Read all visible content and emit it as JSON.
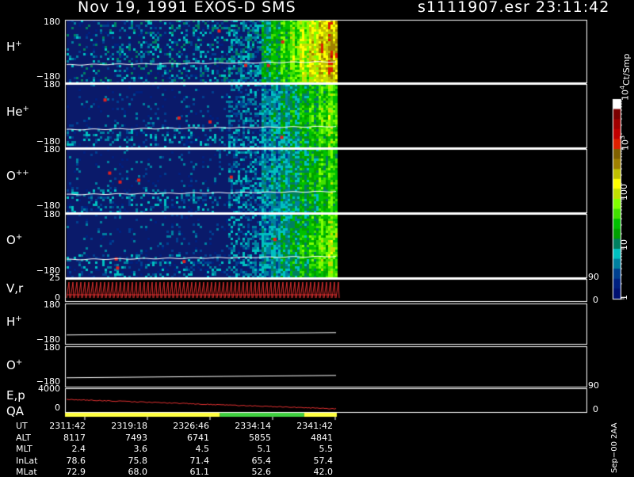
{
  "header": {
    "title": "Nov 19, 1991   EXOS-D SMS",
    "file": "s1111907.esr  23:11:42"
  },
  "panels": [
    {
      "label": "H",
      "sup": "+",
      "ymax": "180",
      "ymin": "−180",
      "type": "spectrogram"
    },
    {
      "label": "He",
      "sup": "+",
      "ymax": "180",
      "ymin": "−180",
      "type": "spectrogram"
    },
    {
      "label": "O",
      "sup": "++",
      "ymax": "180",
      "ymin": "−180",
      "type": "spectrogram"
    },
    {
      "label": "O",
      "sup": "+",
      "ymax": "180",
      "ymin": "−180",
      "type": "spectrogram"
    },
    {
      "label": "V,r",
      "sup": "",
      "ymax": "25",
      "ymin": "0",
      "right_top": "90",
      "right_bottom": "0",
      "type": "line"
    },
    {
      "label": "H",
      "sup": "+",
      "ymax": "180",
      "ymin": "−180",
      "type": "trace"
    },
    {
      "label": "O",
      "sup": "+",
      "ymax": "180",
      "ymin": "−180",
      "type": "trace"
    },
    {
      "label": "E,p",
      "label2": "QA",
      "ymax": "4000",
      "ymin": "0",
      "right_top": "90",
      "right_bottom": "0",
      "type": "line"
    }
  ],
  "colorbar": {
    "label": "Ct/Smp",
    "ticks": [
      {
        "text": "10",
        "sup": "4",
        "value": 10000
      },
      {
        "text": "10",
        "sup": "3",
        "value": 1000
      },
      {
        "text": "100",
        "sup": "",
        "value": 100
      },
      {
        "text": "10",
        "sup": "",
        "value": 10
      },
      {
        "text": "1",
        "sup": "",
        "value": 1
      }
    ],
    "colors": [
      "#ffffff",
      "#7a0000",
      "#a00000",
      "#c00000",
      "#e02000",
      "#806000",
      "#a08000",
      "#c0c000",
      "#ffff00",
      "#c0e000",
      "#80ff00",
      "#40e000",
      "#00c000",
      "#00a000",
      "#008060",
      "#00c0c0",
      "#0080a0",
      "#004090",
      "#002080",
      "#001070"
    ]
  },
  "quality_bar": {
    "segments": [
      {
        "color": "#ffff40",
        "start": 0.0,
        "end": 0.57
      },
      {
        "color": "#40d040",
        "start": 0.57,
        "end": 0.88
      },
      {
        "color": "#ffff40",
        "start": 0.88,
        "end": 1.0
      }
    ]
  },
  "orbit": {
    "rows": [
      {
        "label": "UT",
        "values": [
          "2311:42",
          "2319:18",
          "2326:46",
          "2334:14",
          "2341:42"
        ]
      },
      {
        "label": "ALT",
        "values": [
          "8117",
          "7493",
          "6741",
          "5855",
          "4841"
        ]
      },
      {
        "label": "MLT",
        "values": [
          "2.4",
          "3.6",
          "4.5",
          "5.1",
          "5.5"
        ]
      },
      {
        "label": "InLat",
        "values": [
          "78.6",
          "75.8",
          "71.4",
          "65.4",
          "57.4"
        ]
      },
      {
        "label": "MLat",
        "values": [
          "72.9",
          "68.0",
          "61.1",
          "52.6",
          "42.0"
        ]
      }
    ]
  },
  "footer": "Sep−00 2AA",
  "chart_data": {
    "type": "heatmap",
    "title": "Nov 19, 1991   EXOS-D SMS",
    "x": [
      "2311:42",
      "2319:18",
      "2326:46",
      "2334:14",
      "2341:42"
    ],
    "series": [
      {
        "name": "H+",
        "ylim": [
          -180,
          180
        ]
      },
      {
        "name": "He+",
        "ylim": [
          -180,
          180
        ]
      },
      {
        "name": "O++",
        "ylim": [
          -180,
          180
        ]
      },
      {
        "name": "O+",
        "ylim": [
          -180,
          180
        ]
      }
    ],
    "colorbar_range": [
      1,
      10000
    ],
    "colorbar_unit": "Ct/Smp"
  }
}
